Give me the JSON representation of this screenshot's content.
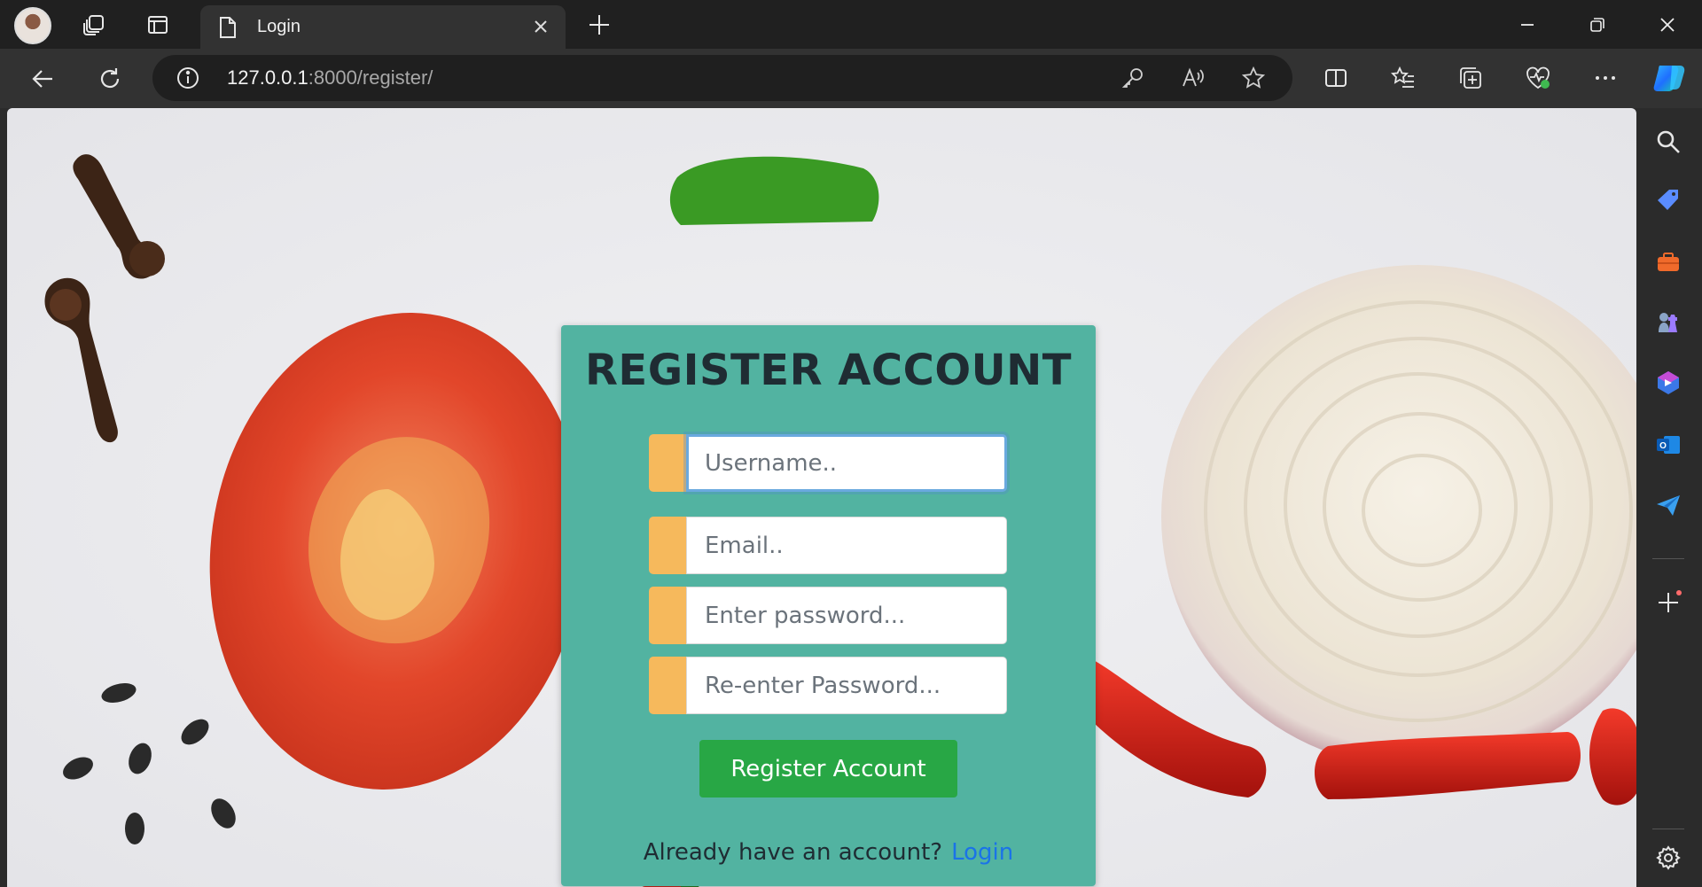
{
  "browser": {
    "tab": {
      "title": "Login"
    },
    "address": {
      "host": "127.0.0.1",
      "path": ":8000/register/"
    }
  },
  "form": {
    "title": "REGISTER ACCOUNT",
    "fields": [
      {
        "placeholder": "Username.."
      },
      {
        "placeholder": "Email.."
      },
      {
        "placeholder": "Enter password..."
      },
      {
        "placeholder": "Re-enter Password..."
      }
    ],
    "submit_label": "Register Account",
    "footer_text": "Already have an account?",
    "login_link": "Login"
  },
  "colors": {
    "card": "#52b3a1",
    "field_prepend": "#f6b95c",
    "submit": "#28a745",
    "link": "#1a73e8"
  }
}
